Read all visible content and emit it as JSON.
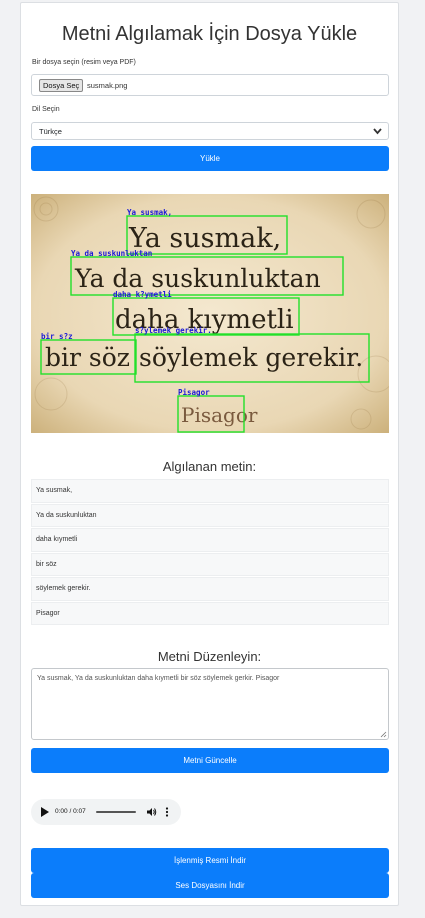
{
  "page": {
    "title": "Metni Algılamak İçin Dosya Yükle"
  },
  "file_input": {
    "label": "Bir dosya seçin (resim veya PDF)",
    "button_label": "Dosya Seç",
    "file_name": "susmak.png"
  },
  "language": {
    "label": "Dil Seçin",
    "selected": "Türkçe"
  },
  "upload_button": "Yükle",
  "image": {
    "main_lines": [
      "Ya susmak,",
      "Ya da suskunluktan",
      "daha kıymetli",
      "bir söz",
      "söylemek gerekir.",
      "Pisagor"
    ],
    "box_labels": [
      "Ya susmak,",
      "Ya da suskunluktan",
      "daha k?ymetli",
      "bir s?z",
      "s?ylemek gerekir.",
      "Pisagor"
    ],
    "box_color": "#22e02a",
    "label_color": "#1a1ad6"
  },
  "detected": {
    "heading": "Algılanan metin:",
    "items": [
      "Ya susmak,",
      "Ya da suskunluktan",
      "daha kıymetli",
      "bir söz",
      "söylemek gerekir.",
      "Pisagor"
    ]
  },
  "editor": {
    "heading": "Metni Düzenleyin:",
    "text": "Ya susmak, Ya da suskunluktan daha kıymetli bir söz söylemek gerkir. Pisagor",
    "update_button": "Metni Güncelle"
  },
  "audio": {
    "time": "0:00 / 0:07",
    "icons": [
      "play-icon",
      "volume-icon",
      "more-options-icon"
    ]
  },
  "downloads": {
    "image_button": "İşlenmiş Resmi İndir",
    "audio_button": "Ses Dosyasını İndir"
  },
  "colors": {
    "primary": "#0b7dfb",
    "card_bg": "#ffffff",
    "page_bg": "#f1f2f4"
  }
}
